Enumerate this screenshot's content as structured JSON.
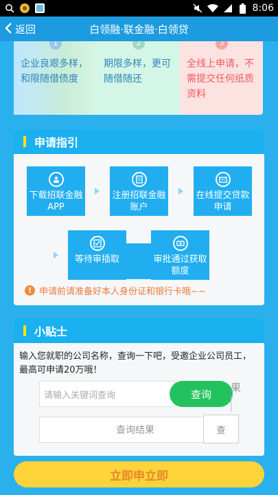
{
  "status_bar": {
    "time": "8:06",
    "left_icons": [
      "search-icon",
      "app-badge-icon",
      "image-icon"
    ],
    "right_icons": [
      "mute-icon",
      "wifi-icon",
      "signal-icon",
      "battery-icon"
    ]
  },
  "nav": {
    "back_label": "返回",
    "title": "白领融·联金融·白领贷"
  },
  "features": [
    {
      "num": "1",
      "text": "企业良艰多样，和限随借债度"
    },
    {
      "num": "2",
      "text": "期限多样，更可随借随还"
    },
    {
      "num": "3",
      "text": "全线上申请，不需提交任何纸质资料"
    }
  ],
  "guide": {
    "title": "申请指引",
    "steps": [
      {
        "label": "下载招联金融APP",
        "icon": "download-icon"
      },
      {
        "label": "注册招联金融账户",
        "icon": "register-icon"
      },
      {
        "label": "在线提交贷款申请",
        "icon": "submit-icon"
      },
      {
        "label": "等待审插取",
        "icon": "check-icon"
      },
      {
        "label": "审批通过获取额度",
        "icon": "money-icon"
      }
    ],
    "note": "申请前请准备好本人身份证和银行卡哦~~"
  },
  "tips": {
    "title": "小贴士",
    "text": "输入您就职的公司名称，查询一下吧，受邀企业公司员工，最高可申请20万哦！",
    "search_placeholder": "请输入关键词查询",
    "search_button": "查询",
    "ghost_label": "果",
    "result_label": "查询结果",
    "ghost_chip": "查"
  },
  "apply_button": "立即申立即",
  "colors": {
    "nav": "#1d9be0",
    "card_head": "#1bb0f0",
    "accent_yellow": "#ffd43a",
    "search_green": "#22c35e"
  }
}
